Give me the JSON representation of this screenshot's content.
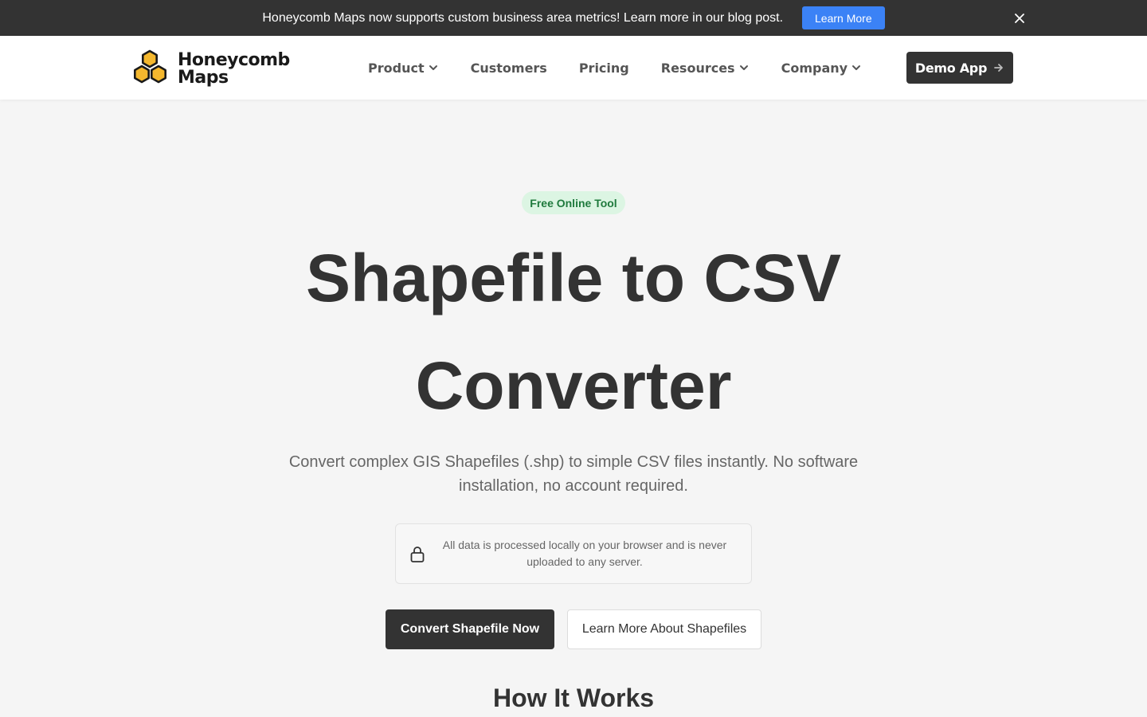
{
  "announcement": {
    "text": "Honeycomb Maps now supports custom business area metrics! Learn more in our blog post.",
    "button_label": "Learn More",
    "close_icon": "close-icon"
  },
  "nav": {
    "logo": {
      "line1": "Honeycomb",
      "line2": "Maps",
      "icon": "honeycomb-logo-icon"
    },
    "items": [
      {
        "label": "Product",
        "has_dropdown": true
      },
      {
        "label": "Customers",
        "has_dropdown": false
      },
      {
        "label": "Pricing",
        "has_dropdown": false
      },
      {
        "label": "Resources",
        "has_dropdown": true
      },
      {
        "label": "Company",
        "has_dropdown": true
      }
    ],
    "demo_button": "Demo App"
  },
  "hero": {
    "badge": "Free Online Tool",
    "title": "Shapefile to CSV Converter",
    "subtitle": "Convert complex GIS Shapefiles (.shp) to simple CSV files instantly. No software installation, no account required.",
    "privacy_note": "All data is processed locally on your browser and is never uploaded to any server.",
    "primary_button": "Convert Shapefile Now",
    "secondary_button": "Learn More About Shapefiles"
  },
  "how_it_works": {
    "heading": "How It Works"
  },
  "colors": {
    "dark": "#333333",
    "accent_blue": "#3b82f6",
    "logo_yellow": "#f5b82e",
    "badge_bg": "#dcf5e3",
    "badge_text": "#1f7a3d"
  }
}
